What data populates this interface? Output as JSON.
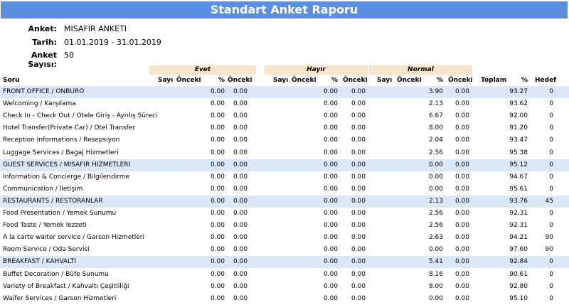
{
  "report": {
    "title": "Standart Anket Raporu",
    "info": [
      {
        "label": "Anket:",
        "value": "MISAFIR ANKETI"
      },
      {
        "label": "Tarih:",
        "value": "01.01.2019 - 31.01.2019"
      },
      {
        "label": "Anket Sayısı:",
        "value": "50"
      }
    ],
    "groups": [
      "Evet",
      "Hayır",
      "Normal"
    ],
    "headers": {
      "soru": "Soru",
      "evet": [
        "Sayı",
        "Önceki",
        "%",
        "Önceki"
      ],
      "hayir": [
        "Sayı",
        "Önceki",
        "%",
        "Önceki"
      ],
      "normal": [
        "Sayı",
        "Önceki",
        "%",
        "Önceki"
      ],
      "toplam": "Toplam",
      "pct": "%",
      "hedef": "Hedef"
    },
    "rows": [
      {
        "label": "FRONT OFFICE / ONBURO",
        "cat": true,
        "evet_pct": "0.00",
        "evet_prev": "0.00",
        "hayir_pct": "0.00",
        "hayir_prev": "0.00",
        "normal_pct": "3.90",
        "normal_prev": "0.00",
        "pct": "93.27",
        "hedef": "0"
      },
      {
        "label": "Welcoming / Karşılama",
        "cat": false,
        "evet_pct": "0.00",
        "evet_prev": "0.00",
        "hayir_pct": "0.00",
        "hayir_prev": "0.00",
        "normal_pct": "2.13",
        "normal_prev": "0.00",
        "pct": "93.62",
        "hedef": "0"
      },
      {
        "label": "Check In - Check Out / Otele Giriş - Ayrılış Süreci",
        "cat": false,
        "evet_pct": "0.00",
        "evet_prev": "0.00",
        "hayir_pct": "0.00",
        "hayir_prev": "0.00",
        "normal_pct": "6.67",
        "normal_prev": "0.00",
        "pct": "92.00",
        "hedef": "0"
      },
      {
        "label": "Hotel Transfer(Private Car) / Otel Transfer",
        "cat": false,
        "evet_pct": "0.00",
        "evet_prev": "0.00",
        "hayir_pct": "0.00",
        "hayir_prev": "0.00",
        "normal_pct": "8.00",
        "normal_prev": "0.00",
        "pct": "91.20",
        "hedef": "0"
      },
      {
        "label": "Reception Informations / Resepsiyon",
        "cat": false,
        "evet_pct": "0.00",
        "evet_prev": "0.00",
        "hayir_pct": "0.00",
        "hayir_prev": "0.00",
        "normal_pct": "2.04",
        "normal_prev": "0.00",
        "pct": "93.47",
        "hedef": "0"
      },
      {
        "label": "Luggage Services / Bagaj Hizmetleri",
        "cat": false,
        "evet_pct": "0.00",
        "evet_prev": "0.00",
        "hayir_pct": "0.00",
        "hayir_prev": "0.00",
        "normal_pct": "2.56",
        "normal_prev": "0.00",
        "pct": "95.38",
        "hedef": "0"
      },
      {
        "label": "GUEST SERVICES / MISAFIR HIZMETLERI",
        "cat": true,
        "evet_pct": "0.00",
        "evet_prev": "0.00",
        "hayir_pct": "0.00",
        "hayir_prev": "0.00",
        "normal_pct": "0.00",
        "normal_prev": "0.00",
        "pct": "95.12",
        "hedef": "0"
      },
      {
        "label": "Information & Concierge / Bilgilendirme",
        "cat": false,
        "evet_pct": "0.00",
        "evet_prev": "0.00",
        "hayir_pct": "0.00",
        "hayir_prev": "0.00",
        "normal_pct": "0.00",
        "normal_prev": "0.00",
        "pct": "94.67",
        "hedef": "0"
      },
      {
        "label": "Communication / İletişim",
        "cat": false,
        "evet_pct": "0.00",
        "evet_prev": "0.00",
        "hayir_pct": "0.00",
        "hayir_prev": "0.00",
        "normal_pct": "0.00",
        "normal_prev": "0.00",
        "pct": "95.61",
        "hedef": "0"
      },
      {
        "label": "RESTAURANTS / RESTORANLAR",
        "cat": true,
        "evet_pct": "0.00",
        "evet_prev": "0.00",
        "hayir_pct": "0.00",
        "hayir_prev": "0.00",
        "normal_pct": "2.13",
        "normal_prev": "0.00",
        "pct": "93.76",
        "hedef": "45"
      },
      {
        "label": "Food Presentation / Yemek Sunumu",
        "cat": false,
        "evet_pct": "0.00",
        "evet_prev": "0.00",
        "hayir_pct": "0.00",
        "hayir_prev": "0.00",
        "normal_pct": "2.56",
        "normal_prev": "0.00",
        "pct": "92.31",
        "hedef": "0"
      },
      {
        "label": "Food Taste / Yemek lezzeti",
        "cat": false,
        "evet_pct": "0.00",
        "evet_prev": "0.00",
        "hayir_pct": "0.00",
        "hayir_prev": "0.00",
        "normal_pct": "2.56",
        "normal_prev": "0.00",
        "pct": "92.31",
        "hedef": "0"
      },
      {
        "label": "A la carte waiter service / Garson Hizmetleri",
        "cat": false,
        "evet_pct": "0.00",
        "evet_prev": "0.00",
        "hayir_pct": "0.00",
        "hayir_prev": "0.00",
        "normal_pct": "2.63",
        "normal_prev": "0.00",
        "pct": "94.21",
        "hedef": "90"
      },
      {
        "label": "Room Service / Oda Servisi",
        "cat": false,
        "evet_pct": "0.00",
        "evet_prev": "0.00",
        "hayir_pct": "0.00",
        "hayir_prev": "0.00",
        "normal_pct": "0.00",
        "normal_prev": "0.00",
        "pct": "97.60",
        "hedef": "90"
      },
      {
        "label": "BREAKFAST / KAHVALTI",
        "cat": true,
        "evet_pct": "0.00",
        "evet_prev": "0.00",
        "hayir_pct": "0.00",
        "hayir_prev": "0.00",
        "normal_pct": "5.41",
        "normal_prev": "0.00",
        "pct": "92.84",
        "hedef": "0"
      },
      {
        "label": "Buffet Decoration / Büfe Sunumu",
        "cat": false,
        "evet_pct": "0.00",
        "evet_prev": "0.00",
        "hayir_pct": "0.00",
        "hayir_prev": "0.00",
        "normal_pct": "8.16",
        "normal_prev": "0.00",
        "pct": "90.61",
        "hedef": "0"
      },
      {
        "label": "Variety of Breakfast / Kahvaltı Çeşitliliği",
        "cat": false,
        "evet_pct": "0.00",
        "evet_prev": "0.00",
        "hayir_pct": "0.00",
        "hayir_prev": "0.00",
        "normal_pct": "8.00",
        "normal_prev": "0.00",
        "pct": "92.80",
        "hedef": "0"
      },
      {
        "label": "Waifer Services / Garson Hizmetleri",
        "cat": false,
        "evet_pct": "0.00",
        "evet_prev": "0.00",
        "hayir_pct": "0.00",
        "hayir_prev": "0.00",
        "normal_pct": "0.00",
        "normal_prev": "0.00",
        "pct": "95.10",
        "hedef": "0"
      }
    ]
  }
}
